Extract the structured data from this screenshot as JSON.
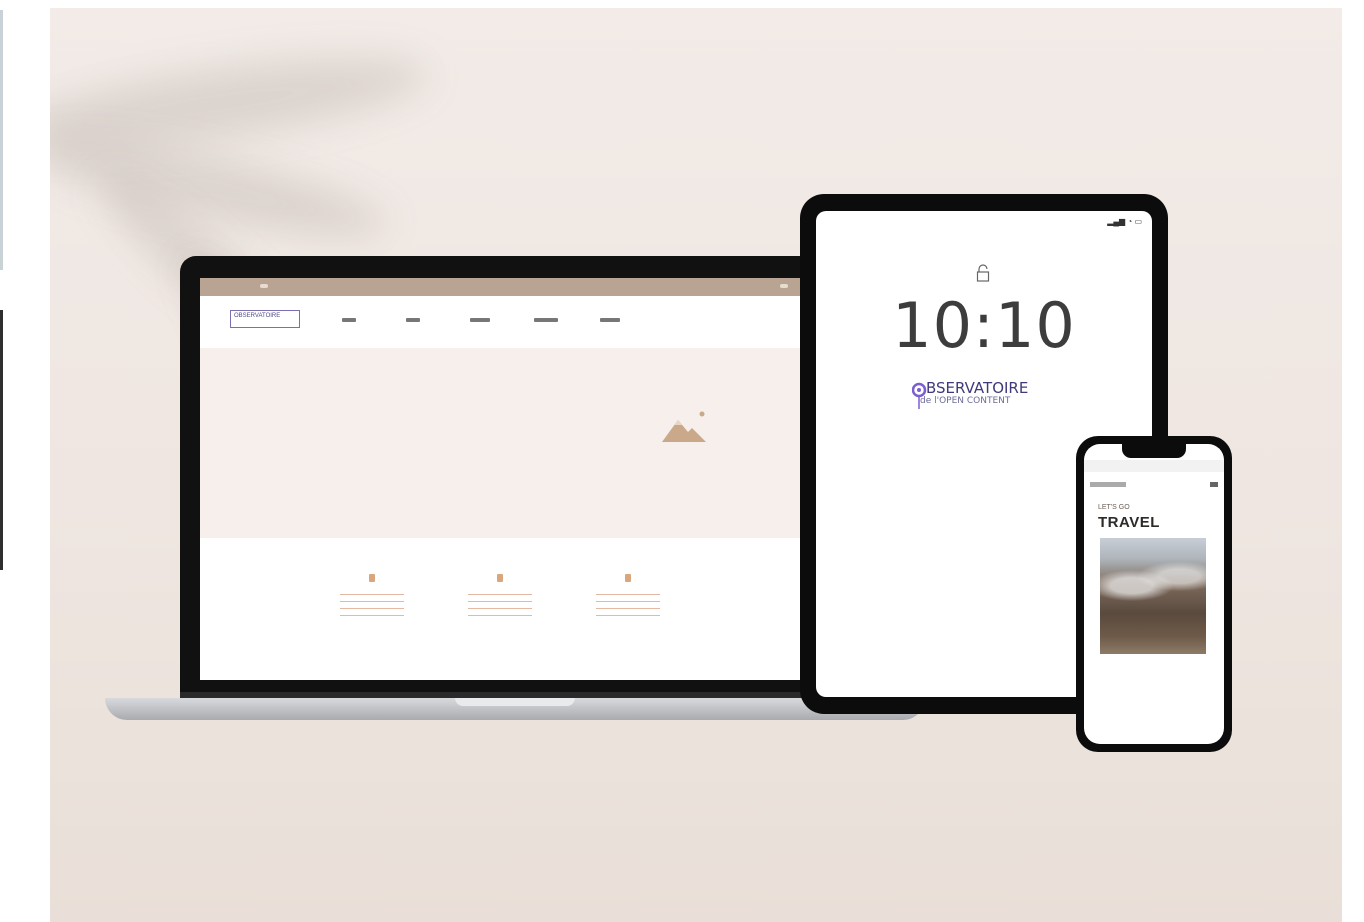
{
  "tablet": {
    "time": "10:10",
    "brand_name": "BSERVATOIRE",
    "brand_sub": "de l'OPEN CONTENT"
  },
  "laptop": {
    "logo_text": "OBSERVATOIRE"
  },
  "phone": {
    "kicker": "LET'S GO",
    "headline": "TRAVEL"
  },
  "colors": {
    "background": "#efe6e1",
    "accent_tan": "#b9a493",
    "brand_purple": "#3f3a7a"
  },
  "icons": [
    "lock-icon",
    "mountain-icon",
    "observatory-logo-icon",
    "menu-icon",
    "signal-icon"
  ]
}
